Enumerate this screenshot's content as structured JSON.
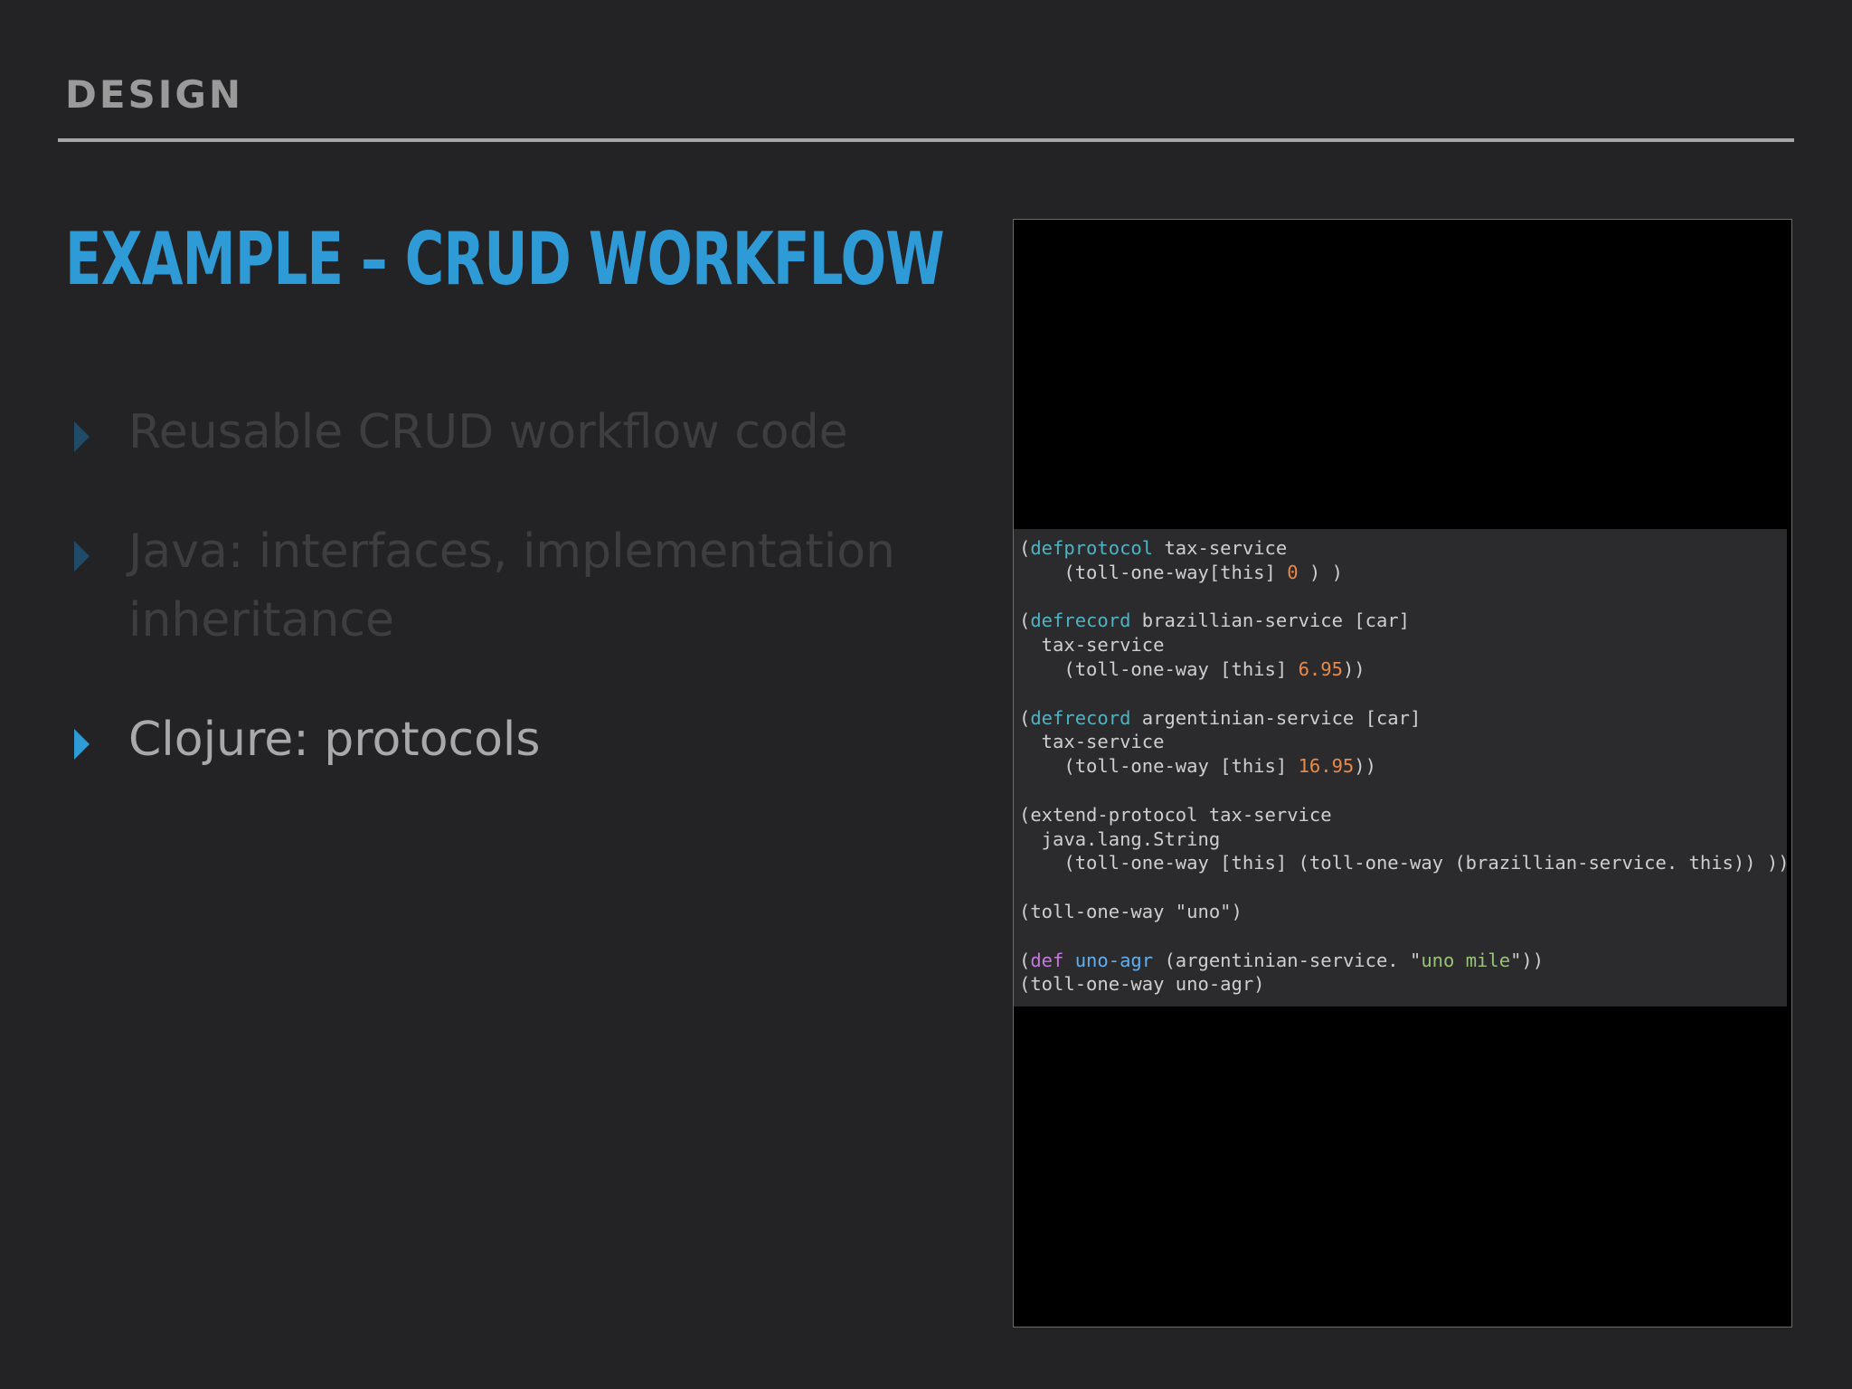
{
  "header": {
    "section": "DESIGN"
  },
  "slide": {
    "title": "EXAMPLE – CRUD WORKFLOW"
  },
  "bullets": [
    {
      "text": "Reusable CRUD workflow code",
      "state": "dim"
    },
    {
      "text": "Java: interfaces, implementation inheritance",
      "state": "dim"
    },
    {
      "text": "Clojure: protocols",
      "state": "active"
    }
  ],
  "code": {
    "lines": [
      [
        {
          "t": "(",
          "c": ""
        },
        {
          "t": "defprotocol",
          "c": "kw"
        },
        {
          "t": " tax-service",
          "c": ""
        }
      ],
      [
        {
          "t": "    (toll-one-way[this] ",
          "c": ""
        },
        {
          "t": "0",
          "c": "num"
        },
        {
          "t": " ) )",
          "c": ""
        }
      ],
      [],
      [
        {
          "t": "(",
          "c": ""
        },
        {
          "t": "defrecord",
          "c": "kw"
        },
        {
          "t": " brazillian-service [car]",
          "c": ""
        }
      ],
      [
        {
          "t": "  tax-service",
          "c": ""
        }
      ],
      [
        {
          "t": "    (toll-one-way [this] ",
          "c": ""
        },
        {
          "t": "6.95",
          "c": "num"
        },
        {
          "t": "))",
          "c": ""
        }
      ],
      [],
      [
        {
          "t": "(",
          "c": ""
        },
        {
          "t": "defrecord",
          "c": "kw"
        },
        {
          "t": " argentinian-service [car]",
          "c": ""
        }
      ],
      [
        {
          "t": "  tax-service",
          "c": ""
        }
      ],
      [
        {
          "t": "    (toll-one-way [this] ",
          "c": ""
        },
        {
          "t": "16.95",
          "c": "num"
        },
        {
          "t": "))",
          "c": ""
        }
      ],
      [],
      [
        {
          "t": "(extend-protocol tax-service",
          "c": ""
        }
      ],
      [
        {
          "t": "  java.lang.String",
          "c": ""
        }
      ],
      [
        {
          "t": "    (toll-one-way [this] (toll-one-way (brazillian-service. this)) ))",
          "c": ""
        }
      ],
      [],
      [
        {
          "t": "(toll-one-way \"uno\")",
          "c": ""
        }
      ],
      [],
      [
        {
          "t": "(",
          "c": ""
        },
        {
          "t": "def",
          "c": "def"
        },
        {
          "t": " ",
          "c": ""
        },
        {
          "t": "uno-agr",
          "c": "sym"
        },
        {
          "t": " (argentinian-service. \"",
          "c": ""
        },
        {
          "t": "uno mile",
          "c": "str"
        },
        {
          "t": "\"))",
          "c": ""
        }
      ],
      [
        {
          "t": "(toll-one-way uno-agr)",
          "c": ""
        }
      ]
    ]
  }
}
